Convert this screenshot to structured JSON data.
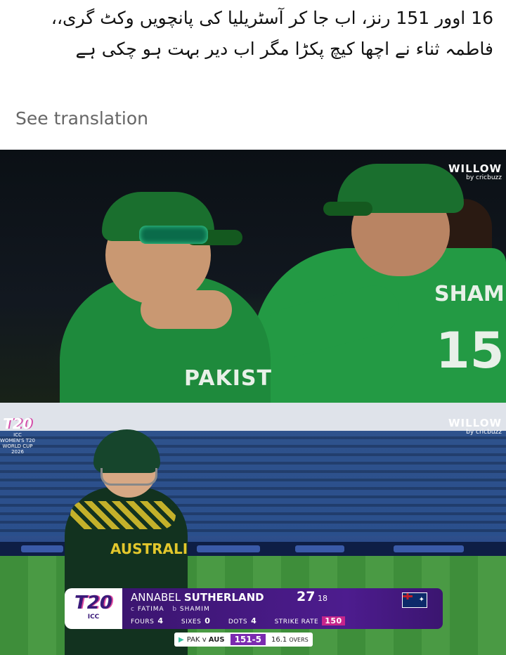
{
  "post": {
    "text": "16 اوور 151 رنز، اب جا کر آسٹریلیا کی پانچویں وکٹ گری،، فاطمہ ثناء نے اچھا کیچ پکڑا مگر اب دیر بہت ہو چکی ہے",
    "see_translation": "See translation"
  },
  "broadcaster": {
    "name": "WILLOW",
    "sub": "by cricbuzz"
  },
  "frame_top": {
    "jersey_left": "PAKIST",
    "jersey_right_name": "SHAMI",
    "jersey_right_number": "15"
  },
  "frame_bottom": {
    "event_logo": {
      "t20": "T20",
      "line1": "ICC",
      "line2": "WOMEN'S T20",
      "line3": "WORLD CUP",
      "line4": "2026"
    },
    "jersey_text": "AUSTRALI"
  },
  "scorecard": {
    "logo_t20": "T20",
    "logo_icc": "ICC",
    "first_name": "ANNABEL",
    "last_name": "SUTHERLAND",
    "runs": "27",
    "balls": "18",
    "caught_tag": "c",
    "caught_by": "FATIMA",
    "bowled_tag": "b",
    "bowled_by": "SHAMIM",
    "fours_label": "FOURS",
    "fours": "4",
    "sixes_label": "SIXES",
    "sixes": "0",
    "dots_label": "DOTS",
    "dots": "4",
    "sr_label": "STRIKE RATE",
    "sr": "150"
  },
  "match_bar": {
    "team1": "PAK",
    "vs": "v",
    "team2": "AUS",
    "score": "151-5",
    "overs": "16.1",
    "overs_label": "OVERS"
  },
  "colors": {
    "scorecard_purple": "#4d1c8e",
    "strike_rate_pink": "#c7258c",
    "pakistan_green": "#1e8a3c"
  }
}
